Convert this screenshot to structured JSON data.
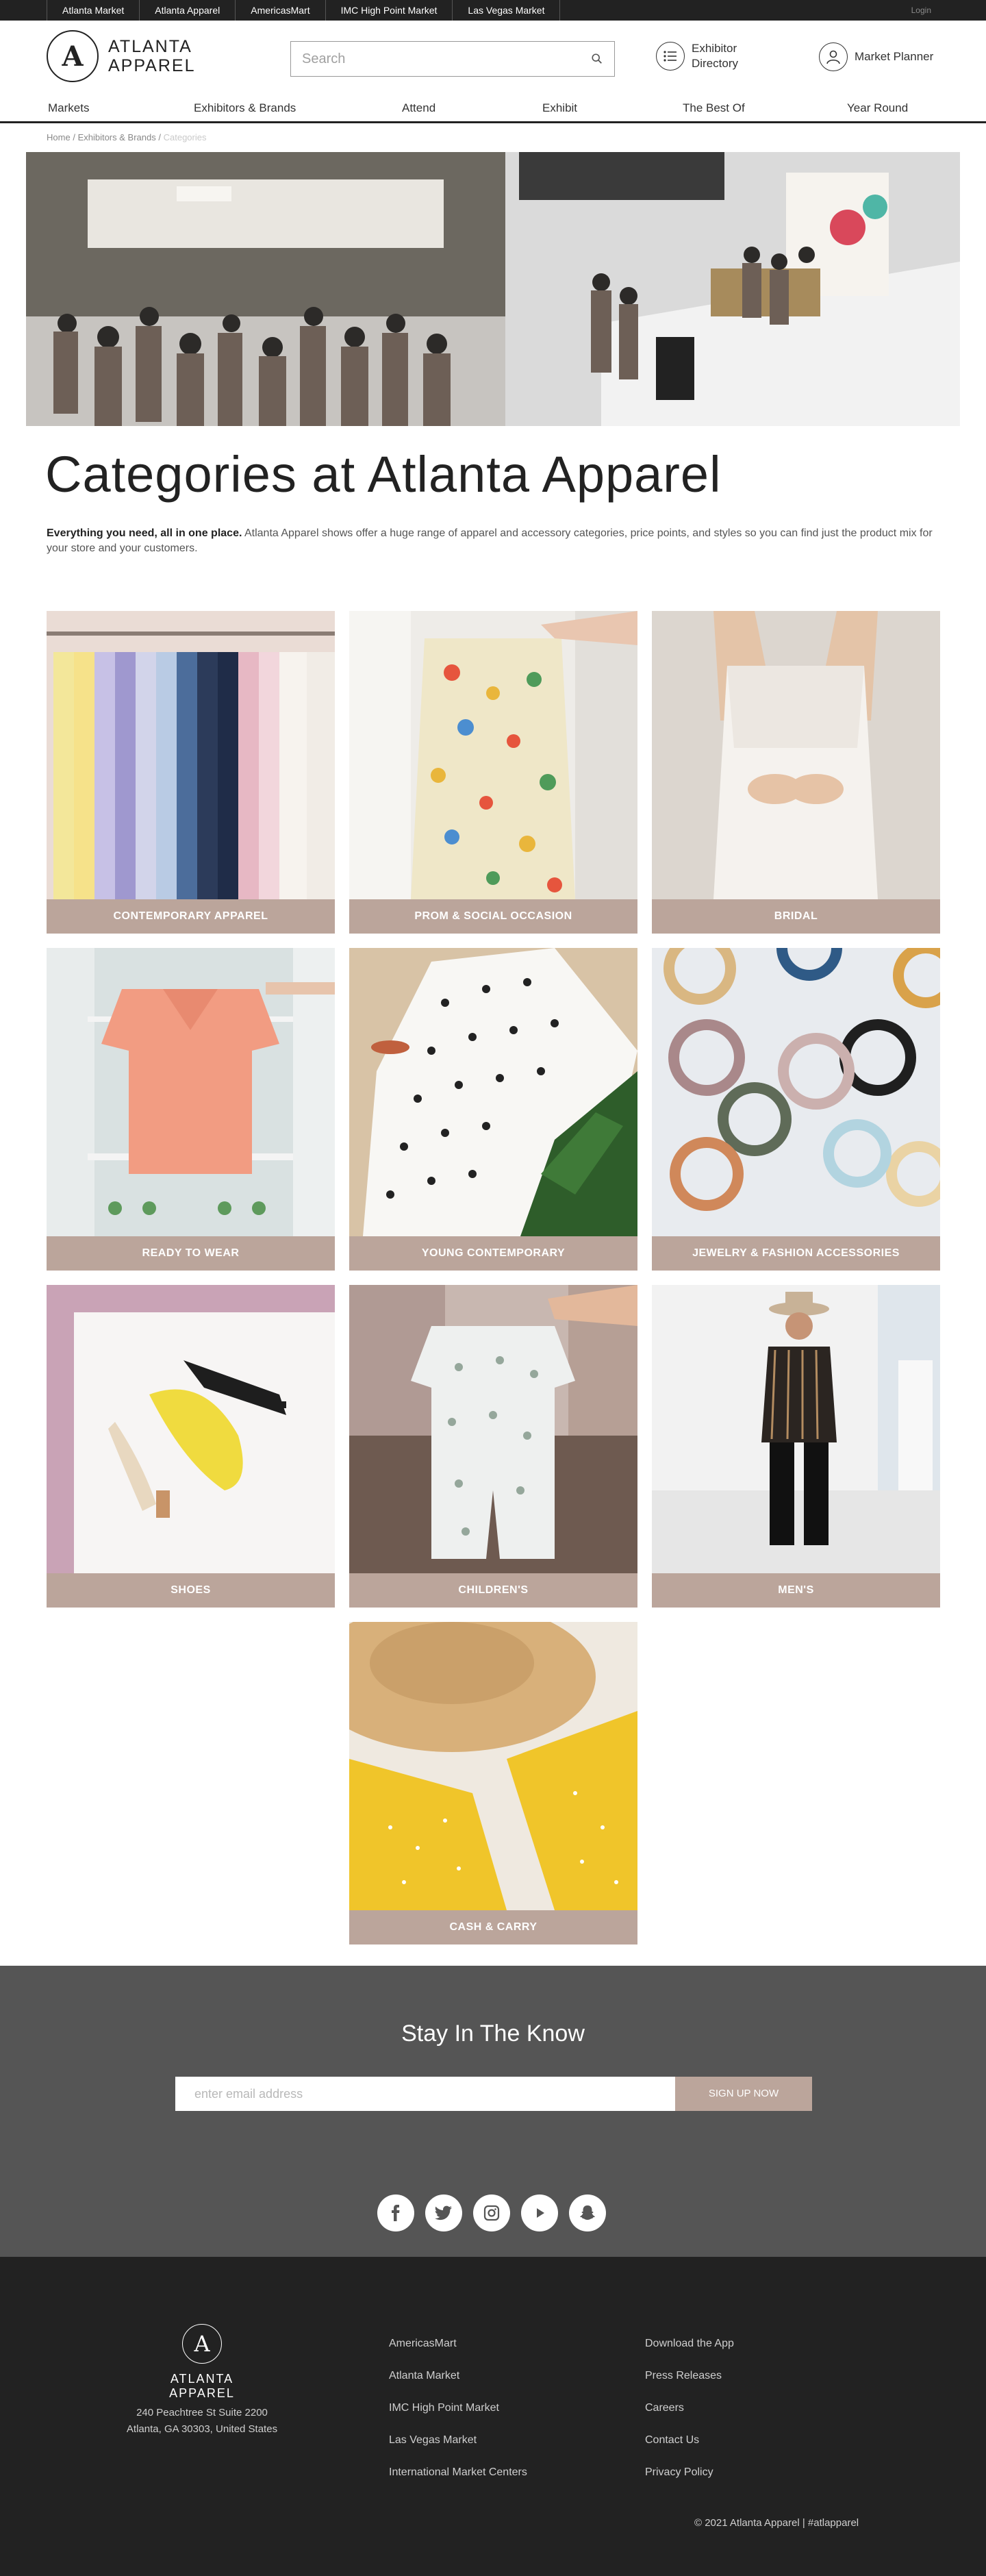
{
  "topbar": {
    "tabs": [
      "Atlanta Market",
      "Atlanta Apparel",
      "AmericasMart",
      "IMC High Point Market",
      "Las Vegas Market"
    ],
    "login": "Login"
  },
  "header": {
    "logo_letter": "A",
    "logo_line1": "ATLANTA",
    "logo_line2": "APPAREL",
    "search_placeholder": "Search",
    "exhibitor_line1": "Exhibitor",
    "exhibitor_line2": "Directory",
    "market_planner": "Market Planner"
  },
  "nav": [
    "Markets",
    "Exhibitors & Brands",
    "Attend",
    "Exhibit",
    "The Best Of",
    "Year Round"
  ],
  "breadcrumb": {
    "home": "Home",
    "sep": "/",
    "exhibitors": "Exhibitors & Brands",
    "current": "Categories"
  },
  "page": {
    "title": "Categories at Atlanta Apparel",
    "intro_bold": "Everything you need, all in one place.",
    "intro_text": " Atlanta Apparel shows offer a huge range of apparel and accessory categories, price points, and styles so you can find just the product mix for your store and your customers."
  },
  "categories": [
    {
      "label": "Contemporary Apparel"
    },
    {
      "label": "Prom & Social Occasion"
    },
    {
      "label": "Bridal"
    },
    {
      "label": "Ready to Wear"
    },
    {
      "label": "Young Contemporary"
    },
    {
      "label": "Jewelry & Fashion Accessories"
    },
    {
      "label": "Shoes"
    },
    {
      "label": "Children's"
    },
    {
      "label": "Men's"
    },
    {
      "label": "Cash & Carry"
    }
  ],
  "newsletter": {
    "title": "Stay In The Know",
    "placeholder": "enter email address",
    "button": "SIGN UP NOW"
  },
  "social": [
    "facebook-icon",
    "twitter-icon",
    "instagram-icon",
    "youtube-icon",
    "snapchat-icon"
  ],
  "footer": {
    "logo_letter": "A",
    "name": "ATLANTA APPAREL",
    "address1": "240 Peachtree St Suite 2200",
    "address2": "Atlanta, GA 30303, United States",
    "col1": [
      "AmericasMart",
      "Atlanta Market",
      "IMC High Point Market",
      "Las Vegas Market",
      "International Market Centers"
    ],
    "col2": [
      "Download the App",
      "Press Releases",
      "Careers",
      "Contact Us",
      "Privacy Policy"
    ],
    "copyright": "© 2021 Atlanta Apparel | #atlapparel"
  },
  "colors": {
    "accent": "#bba59b",
    "dark": "#222222",
    "band": "#555555"
  }
}
